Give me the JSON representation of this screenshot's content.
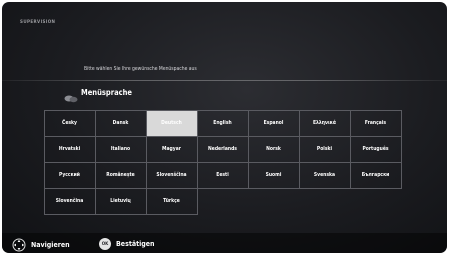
{
  "header": {
    "app_title": "SUPERVISION"
  },
  "instruction": "Bitte wählen Sie Ihre gewünsche Menüspache aus",
  "section": {
    "icon": "speech-bubbles-icon",
    "label": "Menüsprache"
  },
  "languages": [
    [
      "Česky",
      "Dansk",
      "Deutsch",
      "English",
      "Espanol",
      "Ελληνικά",
      "Français"
    ],
    [
      "Hrvatski",
      "Italiano",
      "Magyar",
      "Nederlands",
      "Norsk",
      "Polski",
      "Português"
    ],
    [
      "Русский",
      "Românește",
      "Slovenščina",
      "Eesti",
      "Suomi",
      "Svenska",
      "Български"
    ],
    [
      "Slovenčina",
      "Lietuvių",
      "Türkçe"
    ]
  ],
  "selected_language": "Deutsch",
  "footer": {
    "navigate_icon": "dpad-icon",
    "navigate_label": "Navigieren",
    "ok_icon_label": "OK",
    "confirm_label": "Bestätigen"
  },
  "colors": {
    "background": "#1b1c20",
    "grid_border": "#5a5b61",
    "selected_cell": "#d9d9d9",
    "text": "#ffffff"
  }
}
